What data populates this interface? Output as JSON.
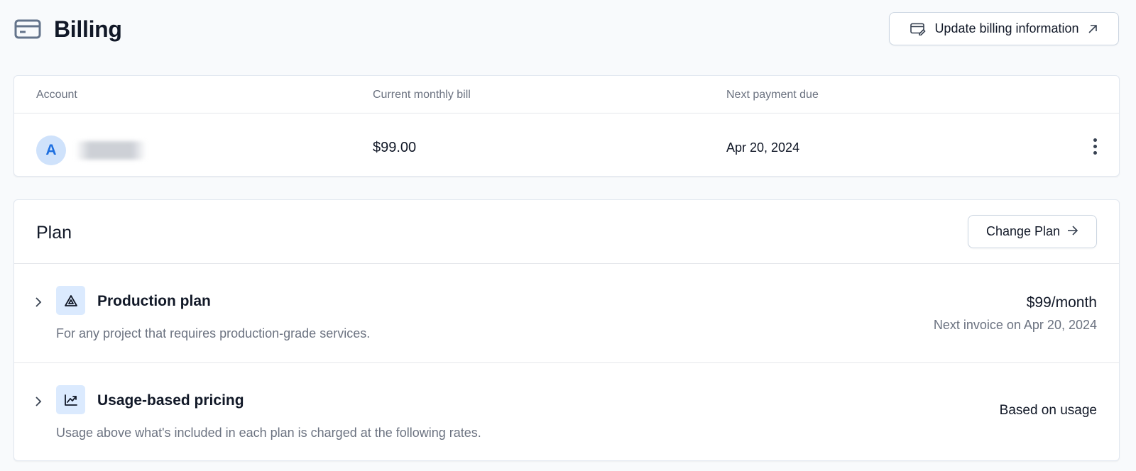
{
  "header": {
    "title": "Billing",
    "icon": "credit-card-icon",
    "update_button": {
      "label": "Update billing information",
      "left_icon": "card-edit-icon",
      "right_icon": "external-arrow-icon"
    }
  },
  "account": {
    "columns": [
      "Account",
      "Current monthly bill",
      "Next payment due"
    ],
    "avatar_initial": "A",
    "name_redacted": true,
    "monthly_bill": "$99.00",
    "next_payment_due": "Apr 20, 2024",
    "menu_icon": "more-vertical-icon"
  },
  "plan": {
    "title": "Plan",
    "change_button": {
      "label": "Change Plan",
      "icon": "arrow-right-icon"
    },
    "items": [
      {
        "icon": "triangle-alert-icon",
        "title": "Production plan",
        "description": "For any project that requires production-grade services.",
        "price": "$99/month",
        "next_invoice": "Next invoice on Apr 20, 2024"
      },
      {
        "icon": "chart-line-icon",
        "title": "Usage-based pricing",
        "description": "Usage above what's included in each plan is charged at the following rates.",
        "price_note": "Based on usage"
      }
    ]
  },
  "colors": {
    "background": "#f8fafc",
    "card": "#ffffff",
    "border": "#e2e8f0",
    "accent": "#1d6fe0",
    "icon_bg": "#dbeafe",
    "muted_text": "#6b7280"
  }
}
